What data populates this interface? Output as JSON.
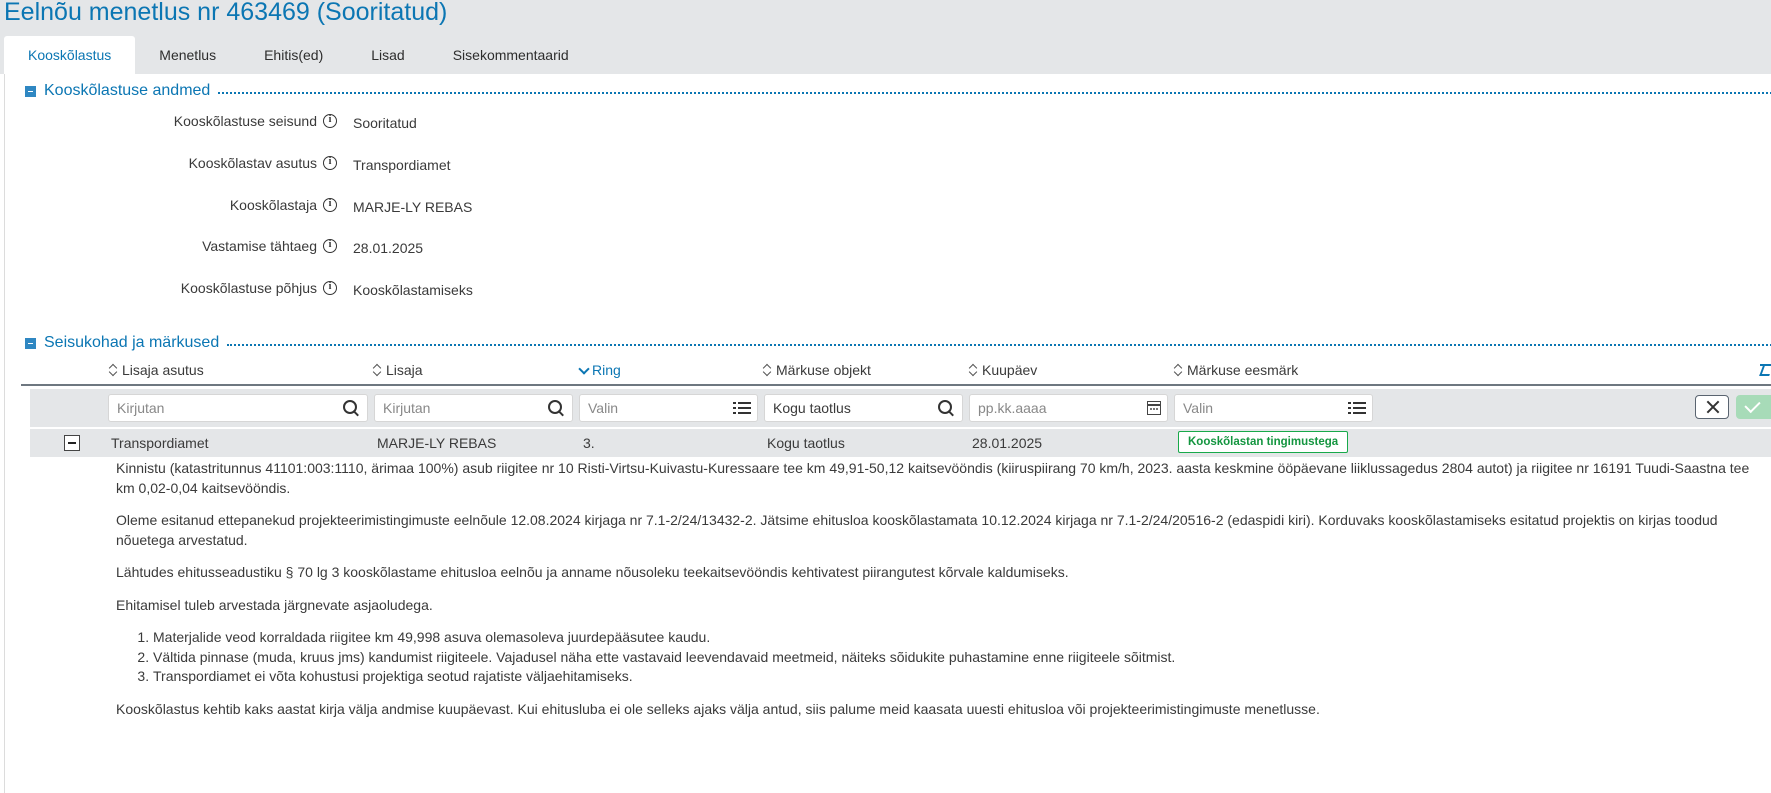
{
  "page_title": "Eelnõu menetlus nr 463469 (Sooritatud)",
  "tabs": [
    {
      "label": "Kooskõlastus",
      "active": true
    },
    {
      "label": "Menetlus",
      "active": false
    },
    {
      "label": "Ehitis(ed)",
      "active": false
    },
    {
      "label": "Lisad",
      "active": false
    },
    {
      "label": "Sisekommentaarid",
      "active": false
    }
  ],
  "section_approval": {
    "title": "Kooskõlastuse andmed",
    "fields": [
      {
        "label": "Kooskõlastuse seisund",
        "value": "Sooritatud"
      },
      {
        "label": "Kooskõlastav asutus",
        "value": "Transpordiamet"
      },
      {
        "label": "Kooskõlastaja",
        "value": "MARJE-LY REBAS"
      },
      {
        "label": "Vastamise tähtaeg",
        "value": "28.01.2025"
      },
      {
        "label": "Kooskõlastuse põhjus",
        "value": "Kooskõlastamiseks"
      }
    ]
  },
  "section_remarks": {
    "title": "Seisukohad ja märkused",
    "columns": [
      "Lisaja asutus",
      "Lisaja",
      "Ring",
      "Märkuse objekt",
      "Kuupäev",
      "Märkuse eesmärk"
    ],
    "sorted_column": "Ring",
    "filters": {
      "lisaja_asutus": {
        "placeholder": "Kirjutan"
      },
      "lisaja": {
        "placeholder": "Kirjutan"
      },
      "ring": {
        "placeholder": "Valin"
      },
      "markuse_objekt": {
        "value": "Kogu taotlus"
      },
      "kuupaev": {
        "placeholder": "pp.kk.aaaa"
      },
      "markuse_eesmark": {
        "placeholder": "Valin"
      }
    },
    "row": {
      "lisaja_asutus": "Transpordiamet",
      "lisaja": "MARJE-LY REBAS",
      "ring": "3.",
      "markuse_objekt": "Kogu taotlus",
      "kuupaev": "28.01.2025",
      "markuse_eesmark": "Kooskõlastan tingimustega"
    },
    "comment": {
      "p1": "Kinnistu (katastritunnus 41101:003:1110, ärimaa 100%) asub riigitee nr 10 Risti-Virtsu-Kuivastu-Kuressaare tee km 49,91-50,12 kaitsevööndis (kiiruspiirang 70 km/h, 2023. aasta keskmine ööpäevane liiklussagedus 2804 autot) ja riigitee nr 16191 Tuudi-Saastna tee km 0,02-0,04 kaitsevööndis.",
      "p2": "Oleme esitanud ettepanekud projekteerimistingimuste eelnõule 12.08.2024 kirjaga nr 7.1-2/24/13432-2. Jätsime ehitusloa kooskõlastamata 10.12.2024 kirjaga nr 7.1-2/24/20516-2 (edaspidi kiri). Korduvaks kooskõlastamiseks esitatud projektis on kirjas toodud nõuetega arvestatud.",
      "p3": "Lähtudes ehitusseadustiku § 70 lg 3 kooskõlastame ehitusloa eelnõu ja anname nõusoleku teekaitsevööndis kehtivatest piirangutest kõrvale kaldumiseks.",
      "p4": "Ehitamisel tuleb arvestada järgnevate asjaoludega.",
      "items": [
        "Materjalide veod korraldada riigitee km 49,998 asuva olemasoleva juurdepääsutee kaudu.",
        "Vältida pinnase (muda, kruus jms) kandumist riigiteele. Vajadusel näha ette vastavaid leevendavaid meetmeid, näiteks sõidukite puhastamine enne riigiteele sõitmist.",
        "Transpordiamet ei võta kohustusi projektiga seotud rajatiste väljaehitamiseks."
      ],
      "p5": "Kooskõlastus kehtib kaks aastat kirja välja andmise kuupäevast. Kui ehitusluba ei ole selleks ajaks välja antud, siis palume meid kaasata uuesti ehitusloa või projekteerimistingimuste menetlusse."
    }
  },
  "colors": {
    "accent": "#0b76b3",
    "header_bg": "#e4e6e8",
    "success": "#18a94a"
  }
}
